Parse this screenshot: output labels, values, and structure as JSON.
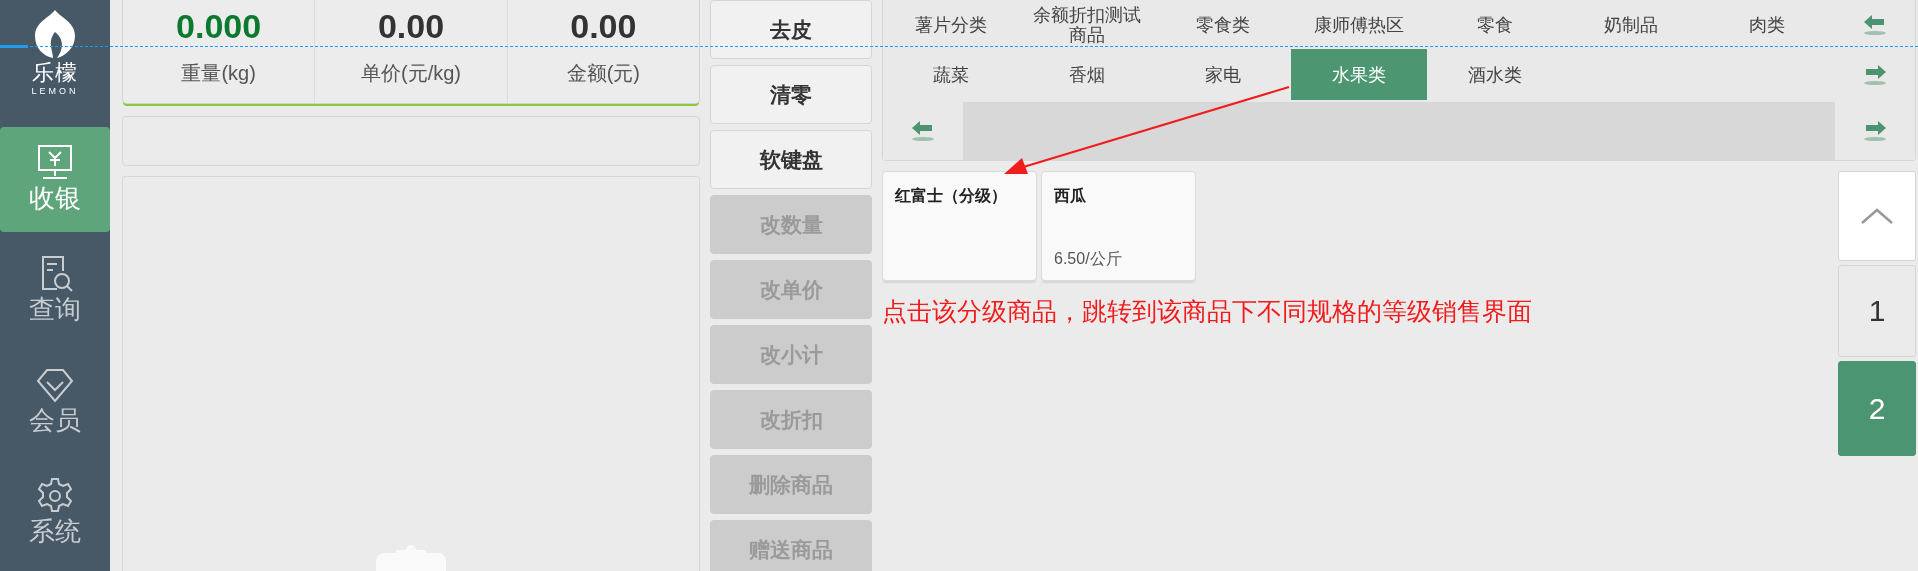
{
  "sidebar": {
    "logo": {
      "name": "乐檬",
      "subtitle": "LEMON"
    },
    "items": [
      {
        "label": "收银",
        "selected": true
      },
      {
        "label": "查询",
        "selected": false
      },
      {
        "label": "会员",
        "selected": false
      },
      {
        "label": "系统",
        "selected": false
      }
    ]
  },
  "scale": {
    "fields": [
      {
        "value": "0.000",
        "label": "重量(kg)",
        "color": "#0b7a2e"
      },
      {
        "value": "0.00",
        "label": "单价(元/kg)",
        "color": "#333333"
      },
      {
        "value": "0.00",
        "label": "金额(元)",
        "color": "#333333"
      }
    ]
  },
  "actions": [
    {
      "label": "去皮",
      "disabled": false
    },
    {
      "label": "清零",
      "disabled": false
    },
    {
      "label": "软键盘",
      "disabled": false
    },
    {
      "label": "改数量",
      "disabled": true
    },
    {
      "label": "改单价",
      "disabled": true
    },
    {
      "label": "改小计",
      "disabled": true
    },
    {
      "label": "改折扣",
      "disabled": true
    },
    {
      "label": "删除商品",
      "disabled": true
    },
    {
      "label": "赠送商品",
      "disabled": true
    }
  ],
  "categories": {
    "rows": [
      [
        {
          "label": "薯片分类",
          "selected": false
        },
        {
          "label": "余额折扣测试商品",
          "selected": false
        },
        {
          "label": "零食类",
          "selected": false
        },
        {
          "label": "康师傅热区",
          "selected": false
        },
        {
          "label": "零食",
          "selected": false
        },
        {
          "label": "奶制品",
          "selected": false
        },
        {
          "label": "肉类",
          "selected": false
        }
      ],
      [
        {
          "label": "蔬菜",
          "selected": false
        },
        {
          "label": "香烟",
          "selected": false
        },
        {
          "label": "家电",
          "selected": false
        },
        {
          "label": "水果类",
          "selected": true
        },
        {
          "label": "酒水类",
          "selected": false
        }
      ]
    ]
  },
  "products": [
    {
      "name": "红富士（分级）"
    },
    {
      "name": "西瓜",
      "price": "6.50/公斤"
    }
  ],
  "pager": {
    "pages": [
      {
        "label": "1",
        "selected": false
      },
      {
        "label": "2",
        "selected": true
      }
    ]
  },
  "annotation": {
    "text": "点击该分级商品，跳转到该商品下不同规格的等级销售界面"
  }
}
